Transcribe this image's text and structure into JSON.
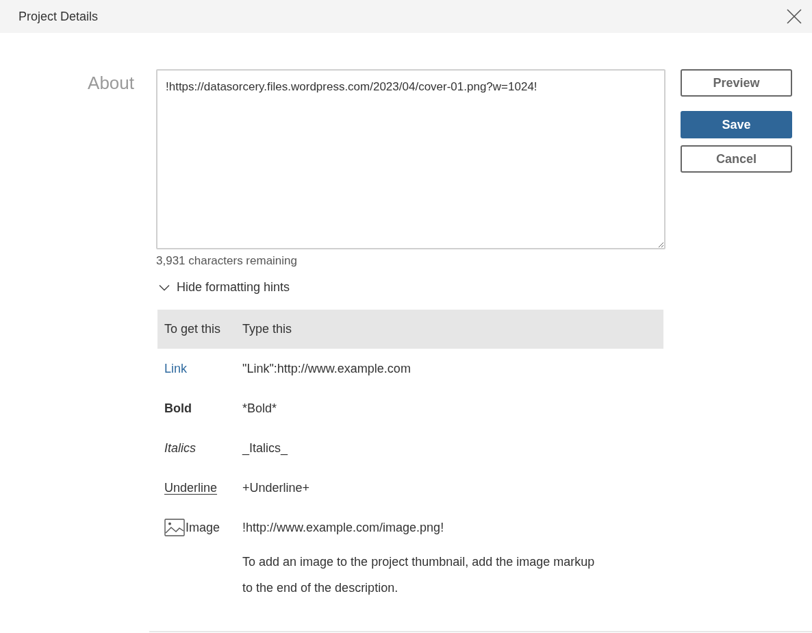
{
  "dialog": {
    "title": "Project Details"
  },
  "about": {
    "label": "About",
    "value": "!https://datasorcery.files.wordpress.com/2023/04/cover-01.png?w=1024!",
    "remaining": "3,931 characters remaining"
  },
  "buttons": [
    {
      "label": "Preview",
      "kind": "secondary"
    },
    {
      "label": "Save",
      "kind": "primary"
    },
    {
      "label": "Cancel",
      "kind": "secondary"
    }
  ],
  "hints": {
    "toggle": "Hide formatting hints",
    "expanded": true,
    "columns": [
      "To get this",
      "Type this"
    ],
    "rows": [
      {
        "kind": "link",
        "result": "Link",
        "markup": "\"Link\":http://www.example.com"
      },
      {
        "kind": "bold",
        "result": "Bold",
        "markup": "*Bold*"
      },
      {
        "kind": "italic",
        "result": "Italics",
        "markup": "_Italics_"
      },
      {
        "kind": "underline",
        "result": "Underline",
        "markup": "+Underline+"
      },
      {
        "kind": "image",
        "result": "Image",
        "markup": "!http://www.example.com/image.png!"
      }
    ],
    "note": "To add an image to the project thumbnail, add the image markup to the end of the description."
  }
}
